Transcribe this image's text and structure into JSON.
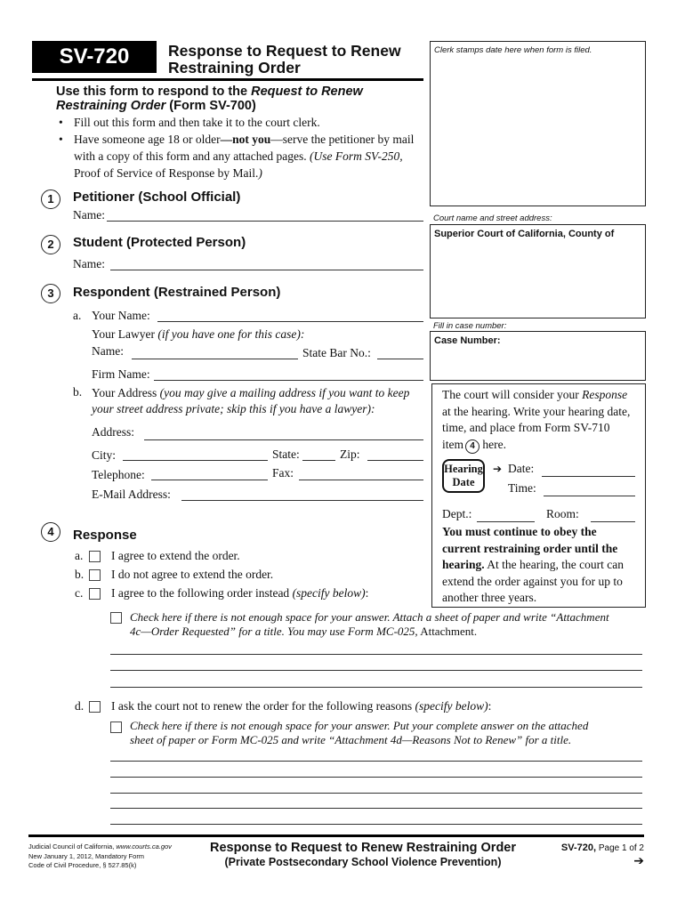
{
  "header": {
    "form_code": "SV-720",
    "title_line1": "Response to Request to Renew",
    "title_line2": "Restraining Order"
  },
  "intro": {
    "heading_pre": "Use this form to respond to the ",
    "heading_italic": "Request to Renew",
    "heading_italic2": "Restraining Order",
    "heading_post": " (Form SV-700)",
    "bullet1": "Fill out this form and then take it to the court clerk.",
    "bullet2_pre": "Have someone age 18 or older",
    "bullet2_bold": "—not you",
    "bullet2_post": "—serve the petitioner by mail",
    "bullet2_line2_pre": "with a copy of this form and any attached pages. ",
    "bullet2_line2_italic": "(Use Form SV-250,",
    "bullet2_line3": "Proof of Service of Response by Mail.",
    "bullet2_line3_close": ")"
  },
  "clerk_box": {
    "label": "Clerk stamps date here when form is filed."
  },
  "court_box": {
    "caption": "Court name and street address:",
    "value": "Superior Court of California, County of"
  },
  "case_box": {
    "caption": "Fill in case number:",
    "label": "Case Number:",
    "value": ""
  },
  "section1": {
    "number": "1",
    "title": "Petitioner (School Official)",
    "name_label": "Name:",
    "name_value": ""
  },
  "section2": {
    "number": "2",
    "title": "Student (Protected Person)",
    "name_label": "Name:",
    "name_value": ""
  },
  "section3": {
    "number": "3",
    "title": "Respondent (Restrained Person)",
    "a_marker": "a.",
    "your_name_label": "Your Name:",
    "your_name_value": "",
    "lawyer_label": "Your Lawyer ",
    "lawyer_italic": "(if you have one for this case):",
    "lawyer_name_label": "Name:",
    "lawyer_name_value": "",
    "state_bar_label": "State Bar No.:",
    "state_bar_value": "",
    "firm_label": "Firm Name:",
    "firm_value": "",
    "b_marker": "b.",
    "address_intro": "Your Address ",
    "address_italic1": "(you may give a mailing address if you want to keep",
    "address_italic2": "your street address private; skip this if you have a lawyer):",
    "address_label": "Address:",
    "address_value": "",
    "city_label": "City:",
    "city_value": "",
    "state_label": "State:",
    "state_value": "",
    "zip_label": "Zip:",
    "zip_value": "",
    "telephone_label": "Telephone:",
    "telephone_value": "",
    "fax_label": "Fax:",
    "fax_value": "",
    "email_label": "E-Mail Address:",
    "email_value": ""
  },
  "hearing_box": {
    "intro1_pre": "The court will consider your ",
    "intro1_italic": "Response",
    "intro2": "at the hearing. Write your hearing date,",
    "intro3": "time, and place from Form SV-710",
    "intro4_pre": "item",
    "intro4_circle": "4",
    "intro4_post": " here.",
    "badge_line1": "Hearing",
    "badge_line2": "Date",
    "arrow": "➔",
    "date_label": "Date:",
    "date_value": "",
    "time_label": "Time:",
    "time_value": "",
    "dept_label": "Dept.:",
    "dept_value": "",
    "room_label": "Room:",
    "room_value": "",
    "warning_bold1": "You must continue to obey the",
    "warning_bold2": "current restraining order until the",
    "warning_bold3": "hearing.",
    "warning_rest3": " At the hearing, the court can",
    "warning_line4": "extend the order against you for up to",
    "warning_line5": "another three years."
  },
  "section4": {
    "number": "4",
    "title": "Response",
    "options": [
      {
        "marker": "a.",
        "label": "I agree to extend the order.",
        "label_italic": "",
        "label_tail": "",
        "checked": false
      },
      {
        "marker": "b.",
        "label": "I do not agree to extend the order.",
        "label_italic": "",
        "label_tail": "",
        "checked": false
      },
      {
        "marker": "c.",
        "label": "I agree to the following order instead ",
        "label_italic": "(specify below)",
        "label_tail": ":",
        "checked": false
      },
      {
        "marker": "d.",
        "label": "I ask the court not to renew the order for the following reasons ",
        "label_italic": "(specify below)",
        "label_tail": ":",
        "checked": false
      }
    ],
    "attach_c_line1": "Check here if there is not enough space for your answer. Attach a sheet of paper and write “Attachment",
    "attach_c_line2_italic": "4c—Order Requested” for a title. You may use Form MC-025,",
    "attach_c_line2_plain": " Attachment.",
    "attach_c_checked": false,
    "attach_d_line1": "Check here if there is not enough space for your answer. Put your complete answer on the attached",
    "attach_d_line2": "sheet of paper or Form MC-025 and write “Attachment 4d—Reasons Not to Renew” for a title.",
    "attach_d_checked": false,
    "c_answer_lines": [
      "",
      "",
      ""
    ],
    "d_answer_lines": [
      "",
      "",
      "",
      "",
      ""
    ]
  },
  "footer": {
    "left1_pre": "Judicial Council of California, ",
    "left1_italic": "www.courts.ca.gov",
    "left2": "New January 1, 2012, Mandatory Form",
    "left3": "Code of Civil Procedure, § 527.85(k)",
    "center1": "Response to Request to Renew Restraining Order",
    "center2": "(Private Postsecondary School Violence Prevention)",
    "right_code": "SV-720,",
    "right_page": " Page 1 of 2",
    "next_arrow": "➔"
  }
}
